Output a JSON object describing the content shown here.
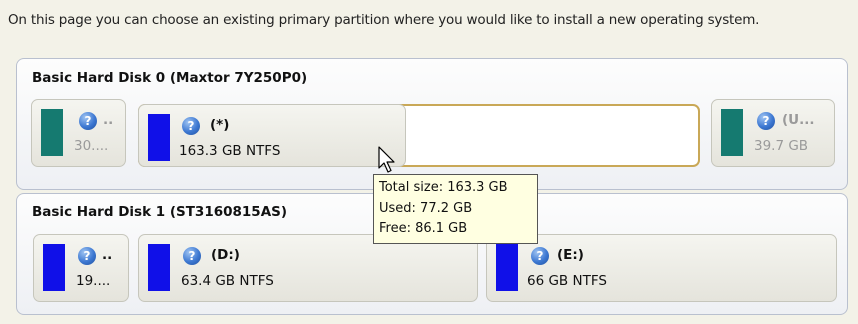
{
  "instruction": "On this page you can choose an existing primary partition where you would like to install a new operating system.",
  "disks": [
    {
      "title": "Basic Hard Disk 0 (Maxtor 7Y250P0)",
      "partitions": [
        {
          "label": "..",
          "size": "30....",
          "color": "#157a70"
        },
        {
          "label": "(*)",
          "size": "163.3 GB NTFS",
          "color": "#1010e8"
        },
        {
          "label": "(U...",
          "size": "39.7 GB",
          "color": "#157a70"
        }
      ]
    },
    {
      "title": "Basic Hard Disk 1 (ST3160815AS)",
      "partitions": [
        {
          "label": "..",
          "size": "19....",
          "color": "#1010e8"
        },
        {
          "label": "(D:)",
          "size": "63.4 GB NTFS",
          "color": "#1010e8"
        },
        {
          "label": "(E:)",
          "size": "66 GB NTFS",
          "color": "#1010e8"
        }
      ]
    }
  ],
  "tooltip": {
    "total": "Total size: 163.3 GB",
    "used": "Used: 77.2 GB",
    "free": "Free: 86.1 GB"
  },
  "icons": {
    "partition": "help-question-icon",
    "cursor": "mouse-pointer-icon"
  }
}
